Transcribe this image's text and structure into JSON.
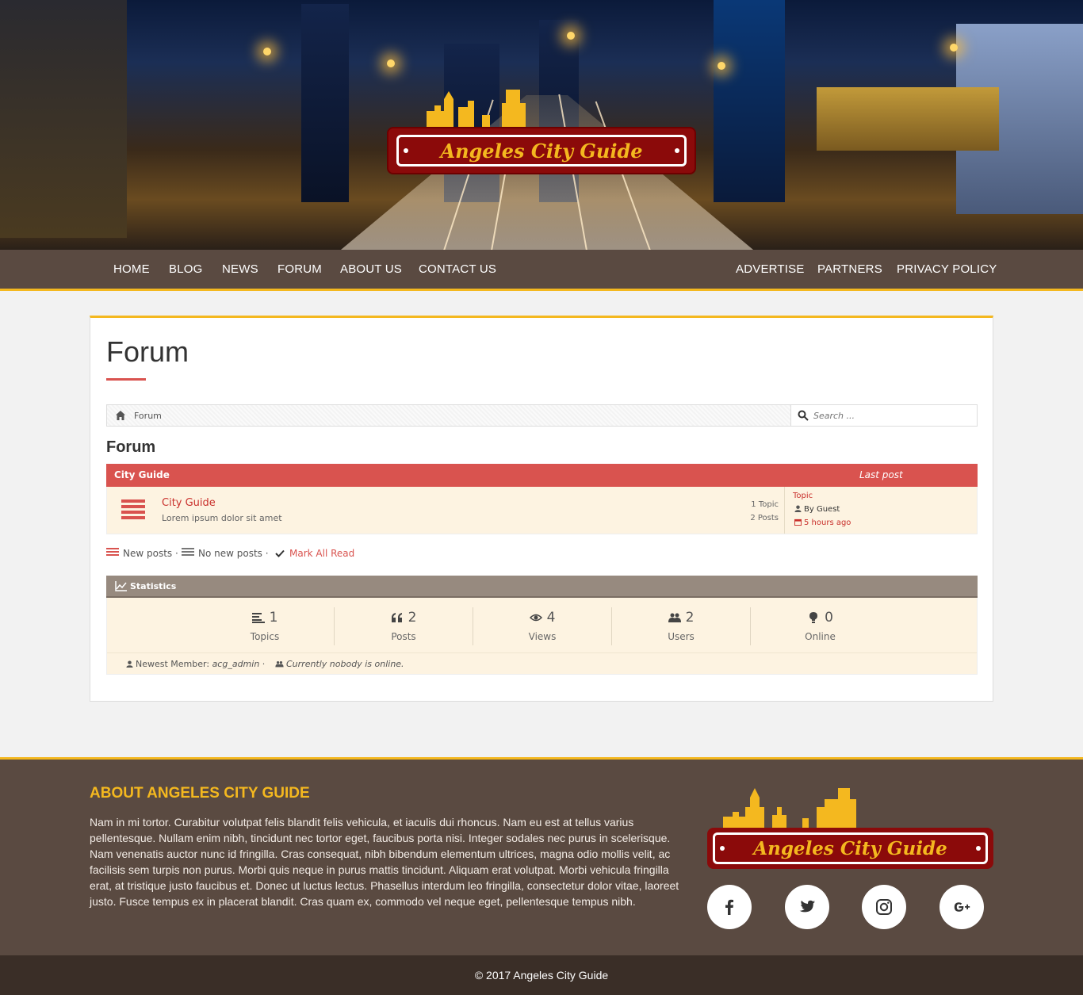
{
  "site": {
    "logo_text": "Angeles City Guide"
  },
  "nav": {
    "left": [
      "HOME",
      "BLOG",
      "NEWS",
      "FORUM",
      "ABOUT US",
      "CONTACT US"
    ],
    "right": [
      "ADVERTISE",
      "PARTNERS",
      "PRIVACY POLICY"
    ]
  },
  "page": {
    "title": "Forum"
  },
  "breadcrumb": {
    "label": "Forum"
  },
  "search": {
    "placeholder": "Search ..."
  },
  "forum": {
    "heading": "Forum",
    "category": {
      "name": "City Guide",
      "last_post_label": "Last post"
    },
    "row": {
      "title": "City Guide",
      "description": "Lorem ipsum dolor sit amet",
      "topics": "1 Topic",
      "posts": "2 Posts",
      "last_topic": "Topic",
      "last_by_prefix": "By",
      "last_by_user": "Guest",
      "last_time": "5 hours ago"
    },
    "legend": {
      "new_posts": "New posts",
      "no_new_posts": "No new posts",
      "mark_all_read": "Mark All Read"
    }
  },
  "statistics": {
    "title": "Statistics",
    "items": [
      {
        "icon": "list-icon",
        "value": "1",
        "label": "Topics"
      },
      {
        "icon": "quote-icon",
        "value": "2",
        "label": "Posts"
      },
      {
        "icon": "eye-icon",
        "value": "4",
        "label": "Views"
      },
      {
        "icon": "users-icon",
        "value": "2",
        "label": "Users"
      },
      {
        "icon": "lightbulb-icon",
        "value": "0",
        "label": "Online"
      }
    ],
    "newest_member_label": "Newest Member:",
    "newest_member": "acg_admin",
    "online_text": "Currently nobody is online."
  },
  "footer": {
    "title": "ABOUT ANGELES CITY GUIDE",
    "text": "Nam in mi tortor. Curabitur volutpat felis blandit felis vehicula, et iaculis dui rhoncus. Nam eu est at tellus varius pellentesque. Nullam enim nibh, tincidunt nec tortor eget, faucibus porta nisi. Integer sodales nec purus in scelerisque. Nam venenatis auctor nunc id fringilla. Cras consequat, nibh bibendum elementum ultrices, magna odio mollis velit, ac facilisis sem turpis non purus. Morbi quis neque in purus mattis tincidunt. Aliquam erat volutpat. Morbi vehicula fringilla erat, at tristique justo faucibus et. Donec ut luctus lectus. Phasellus interdum leo fringilla, consectetur dolor vitae, laoreet justo. Fusce tempus ex in placerat blandit. Cras quam ex, commodo vel neque eget, pellentesque tempus nibh.",
    "social": [
      "facebook-icon",
      "twitter-icon",
      "instagram-icon",
      "google-plus-icon"
    ],
    "copyright": "© 2017 Angeles City Guide"
  },
  "colors": {
    "brand_brown": "#5a4a41",
    "accent_gold": "#f4b81f",
    "forum_red": "#d9534f",
    "logo_red": "#8b0a0a",
    "row_cream": "#fdf3e1"
  }
}
